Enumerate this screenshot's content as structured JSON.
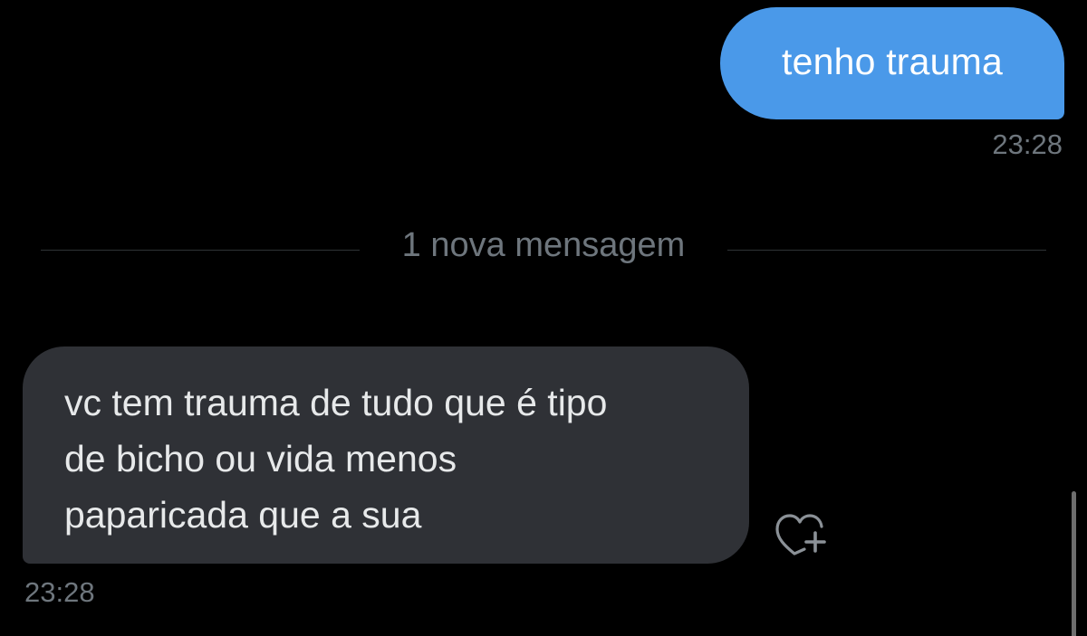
{
  "conversation": {
    "sent_message": {
      "text": "tenho trauma",
      "time": "23:28"
    },
    "divider": {
      "label": "1 nova mensagem"
    },
    "received_message": {
      "lines": [
        "vc tem trauma de tudo que é tipo",
        "de bicho ou vida menos",
        "paparicada que a sua"
      ],
      "time": "23:28"
    },
    "reaction_icon": "heart-plus-icon"
  },
  "colors": {
    "background": "#000000",
    "sent_bubble": "#4a99e9",
    "received_bubble": "#2f3136",
    "secondary_text": "#6e767d"
  }
}
